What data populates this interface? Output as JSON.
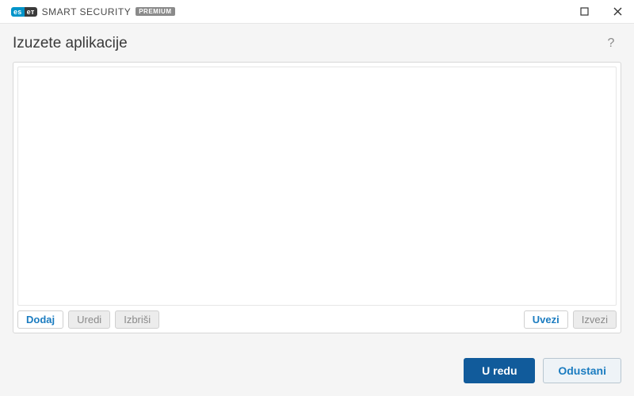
{
  "brand": {
    "logo_left": "es",
    "logo_right": "eт",
    "product": "SMART SECURITY",
    "tier": "PREMIUM"
  },
  "page": {
    "title": "Izuzete aplikacije"
  },
  "toolbar": {
    "add": "Dodaj",
    "edit": "Uredi",
    "delete": "Izbriši",
    "import": "Uvezi",
    "export": "Izvezi"
  },
  "footer": {
    "ok": "U redu",
    "cancel": "Odustani"
  },
  "list": {
    "items": []
  }
}
